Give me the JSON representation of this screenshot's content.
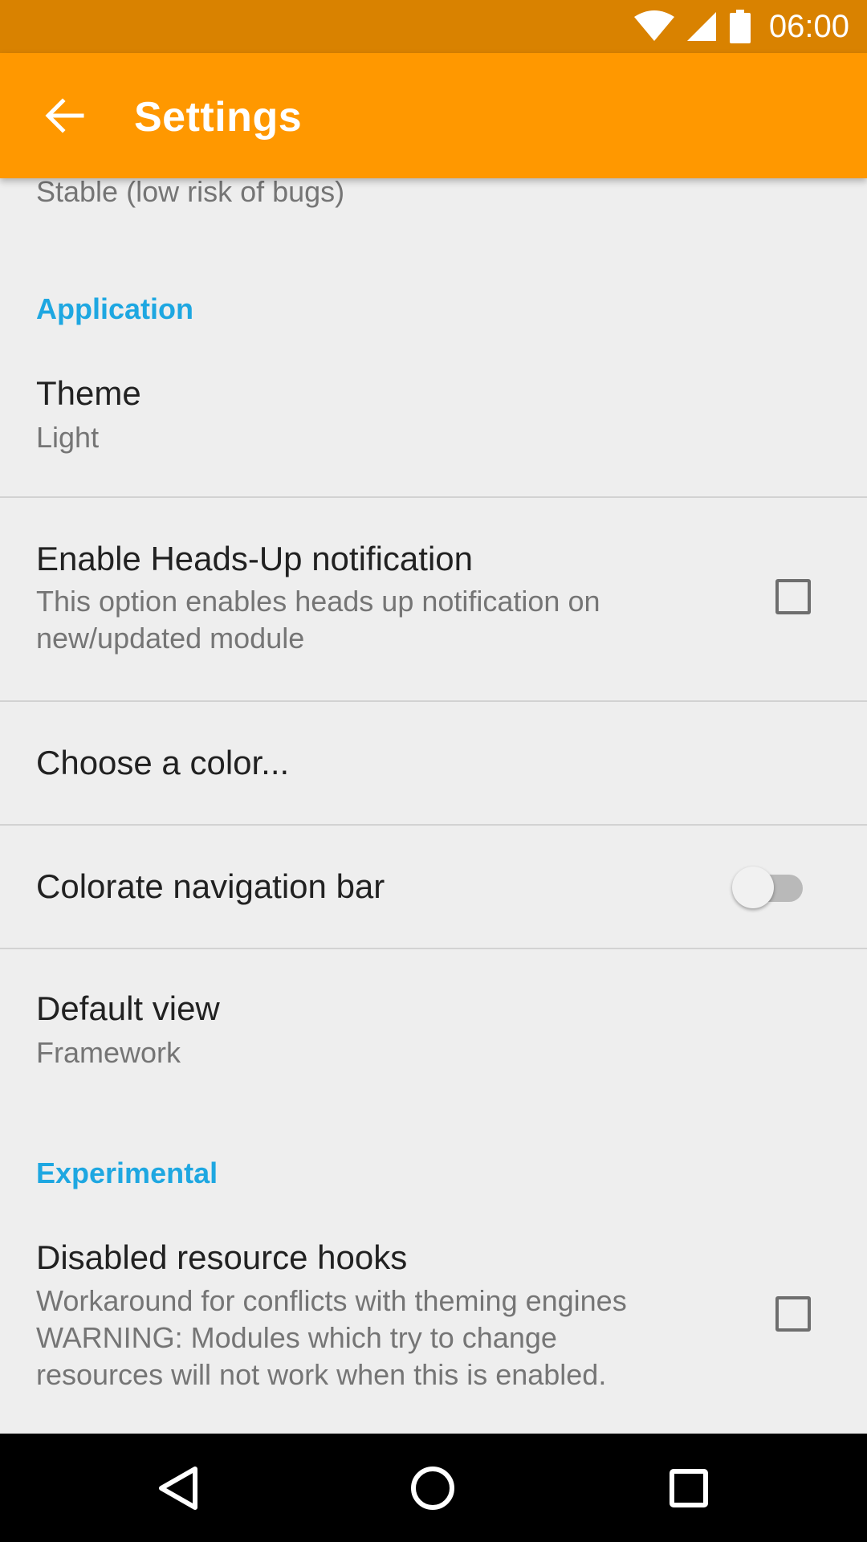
{
  "status_bar": {
    "time": "06:00",
    "icons": [
      "wifi-icon",
      "cell-signal-icon",
      "battery-icon"
    ]
  },
  "toolbar": {
    "title": "Settings",
    "back_icon": "arrow-back-icon"
  },
  "colors": {
    "status_bar": "#d98200",
    "toolbar": "#ff9800",
    "category_text": "#1ea7e1",
    "background": "#eeeeee"
  },
  "prefs": {
    "update_channel_summary": "Stable (low risk of bugs)",
    "category_application": "Application",
    "theme": {
      "title": "Theme",
      "summary": "Light"
    },
    "heads_up": {
      "title": "Enable Heads-Up notification",
      "summary_line1": "This option enables heads up notification on",
      "summary_line2": "new/updated module",
      "checked": false
    },
    "choose_color": {
      "title": "Choose a color..."
    },
    "colorate_nav": {
      "title": "Colorate navigation bar",
      "enabled": false
    },
    "default_view": {
      "title": "Default view",
      "summary": "Framework"
    },
    "category_experimental": "Experimental",
    "resource_hooks": {
      "title": "Disabled resource hooks",
      "summary_line1": "Workaround for conflicts with theming engines",
      "summary_line2": "WARNING: Modules which try to change",
      "summary_line3": "resources will not work when this is enabled.",
      "checked": false
    }
  },
  "nav_bar": {
    "buttons": [
      "back-triangle-icon",
      "home-circle-icon",
      "recents-square-icon"
    ]
  }
}
